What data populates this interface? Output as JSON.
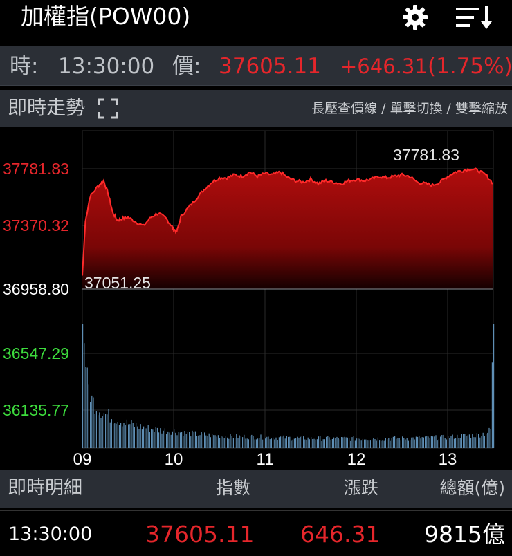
{
  "header": {
    "title": "加權指(POW00)",
    "icons": [
      "gear-icon",
      "sort-menu-icon"
    ]
  },
  "quote": {
    "time_label": "時:",
    "time_value": "13:30:00",
    "price_label": "價:",
    "price_value": "37605.11",
    "change_value": "+646.31",
    "change_pct": "(1.75%)"
  },
  "trend": {
    "title": "即時走勢",
    "hint": "長壓查價線 / 單擊切換 / 雙擊縮放"
  },
  "chart_data": {
    "type": "area",
    "x_ticks": [
      "09",
      "10",
      "11",
      "12",
      "13"
    ],
    "y_ticks": [
      {
        "value": 37781.83,
        "label": "37781.83",
        "color": "#e5262b"
      },
      {
        "value": 37370.32,
        "label": "37370.32",
        "color": "#e5262b"
      },
      {
        "value": 36958.8,
        "label": "36958.80",
        "color": "#ffffff"
      },
      {
        "value": 36547.29,
        "label": "36547.29",
        "color": "#3ddc3d"
      },
      {
        "value": 36135.77,
        "label": "36135.77",
        "color": "#3ddc3d"
      }
    ],
    "ylim": [
      36958.8,
      37781.83
    ],
    "reference": 36958.8,
    "high_label": "37781.83",
    "low_label": "37051.25",
    "x_range_minutes": [
      0,
      270
    ],
    "price_series": [
      [
        0,
        37051
      ],
      [
        2,
        37420
      ],
      [
        5,
        37590
      ],
      [
        10,
        37660
      ],
      [
        14,
        37700
      ],
      [
        17,
        37610
      ],
      [
        20,
        37480
      ],
      [
        23,
        37430
      ],
      [
        26,
        37440
      ],
      [
        30,
        37450
      ],
      [
        35,
        37420
      ],
      [
        40,
        37390
      ],
      [
        45,
        37450
      ],
      [
        50,
        37480
      ],
      [
        55,
        37440
      ],
      [
        58,
        37400
      ],
      [
        60,
        37370
      ],
      [
        62,
        37350
      ],
      [
        65,
        37460
      ],
      [
        70,
        37520
      ],
      [
        75,
        37580
      ],
      [
        80,
        37640
      ],
      [
        85,
        37690
      ],
      [
        90,
        37720
      ],
      [
        95,
        37720
      ],
      [
        100,
        37740
      ],
      [
        105,
        37730
      ],
      [
        110,
        37760
      ],
      [
        115,
        37730
      ],
      [
        120,
        37750
      ],
      [
        125,
        37740
      ],
      [
        130,
        37760
      ],
      [
        135,
        37720
      ],
      [
        140,
        37700
      ],
      [
        145,
        37690
      ],
      [
        150,
        37710
      ],
      [
        155,
        37680
      ],
      [
        160,
        37700
      ],
      [
        165,
        37690
      ],
      [
        170,
        37680
      ],
      [
        175,
        37700
      ],
      [
        180,
        37710
      ],
      [
        185,
        37700
      ],
      [
        190,
        37710
      ],
      [
        195,
        37730
      ],
      [
        200,
        37720
      ],
      [
        205,
        37730
      ],
      [
        210,
        37740
      ],
      [
        215,
        37730
      ],
      [
        220,
        37690
      ],
      [
        225,
        37680
      ],
      [
        230,
        37670
      ],
      [
        235,
        37690
      ],
      [
        240,
        37730
      ],
      [
        245,
        37760
      ],
      [
        250,
        37770
      ],
      [
        255,
        37782
      ],
      [
        260,
        37770
      ],
      [
        265,
        37740
      ],
      [
        270,
        37680
      ]
    ],
    "volume_profile": [
      [
        0,
        1.0
      ],
      [
        1,
        0.92
      ],
      [
        3,
        0.55
      ],
      [
        6,
        0.4
      ],
      [
        10,
        0.33
      ],
      [
        15,
        0.28
      ],
      [
        20,
        0.25
      ],
      [
        30,
        0.2
      ],
      [
        40,
        0.17
      ],
      [
        50,
        0.15
      ],
      [
        60,
        0.14
      ],
      [
        70,
        0.12
      ],
      [
        90,
        0.1
      ],
      [
        120,
        0.09
      ],
      [
        150,
        0.08
      ],
      [
        180,
        0.08
      ],
      [
        210,
        0.08
      ],
      [
        240,
        0.09
      ],
      [
        260,
        0.11
      ],
      [
        266,
        0.13
      ],
      [
        268,
        0.15
      ],
      [
        269,
        0.7
      ],
      [
        270,
        1.0
      ]
    ],
    "colors": {
      "area": "#a30b0b",
      "line": "#ff2a2a",
      "volume": "#5f8fb5",
      "grid": "#2a2a2a"
    }
  },
  "detail": {
    "title": "即時明細",
    "col_index": "指數",
    "col_change": "漲跌",
    "col_amount": "總額(億)",
    "row": {
      "time": "13:30:00",
      "index": "37605.11",
      "change": "646.31",
      "amount": "9815億"
    }
  }
}
